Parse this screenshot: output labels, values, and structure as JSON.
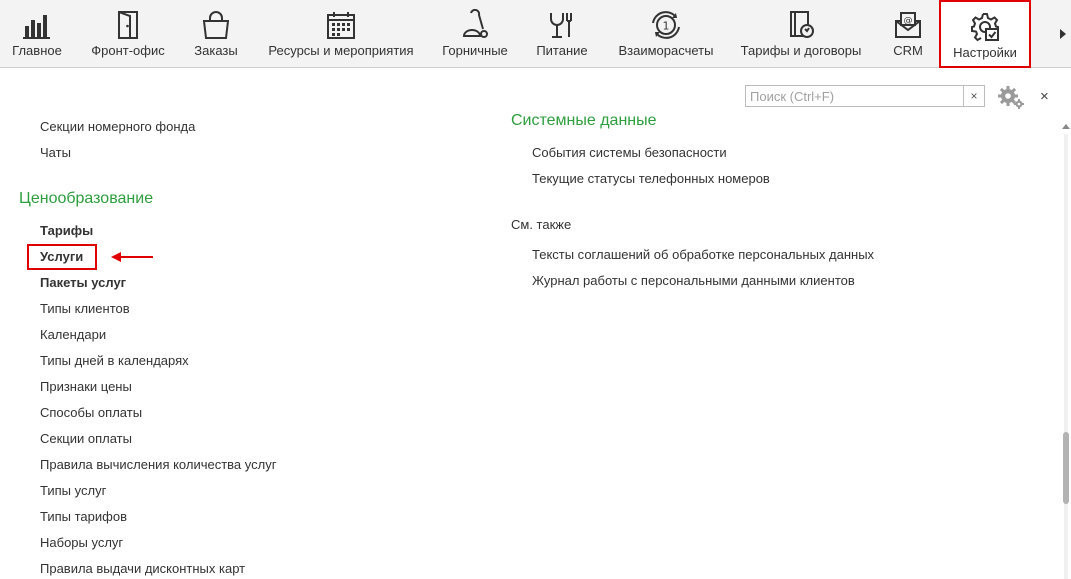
{
  "toolbar": {
    "items": [
      {
        "label": "Главное",
        "icon": "bar-chart-icon"
      },
      {
        "label": "Фронт-офис",
        "icon": "door-icon"
      },
      {
        "label": "Заказы",
        "icon": "shopping-bag-icon"
      },
      {
        "label": "Ресурсы и мероприятия",
        "icon": "calendar-icon"
      },
      {
        "label": "Горничные",
        "icon": "vacuum-icon"
      },
      {
        "label": "Питание",
        "icon": "cup-fork-icon"
      },
      {
        "label": "Взаиморасчеты",
        "icon": "coin-cycle-icon"
      },
      {
        "label": "Тарифы и договоры",
        "icon": "contract-icon"
      },
      {
        "label": "CRM",
        "icon": "crm-envelope-icon"
      },
      {
        "label": "Настройки",
        "icon": "settings-gear-icon"
      }
    ],
    "active_index": 9
  },
  "search": {
    "placeholder": "Поиск (Ctrl+F)",
    "value": "",
    "clear_label": "×"
  },
  "close_label": "×",
  "left_column": {
    "top_items": [
      "Секции номерного фонда",
      "Чаты"
    ],
    "pricing_group": {
      "title": "Ценообразование",
      "items": [
        {
          "label": "Тарифы",
          "bold": true
        },
        {
          "label": "Услуги",
          "bold": true
        },
        {
          "label": "Пакеты услуг",
          "bold": true
        },
        {
          "label": "Типы клиентов",
          "bold": false
        },
        {
          "label": "Календари",
          "bold": false
        },
        {
          "label": "Типы дней в календарях",
          "bold": false
        },
        {
          "label": "Признаки цены",
          "bold": false
        },
        {
          "label": "Способы оплаты",
          "bold": false
        },
        {
          "label": "Секции оплаты",
          "bold": false
        },
        {
          "label": "Правила вычисления количества услуг",
          "bold": false
        },
        {
          "label": "Типы услуг",
          "bold": false
        },
        {
          "label": "Типы тарифов",
          "bold": false
        },
        {
          "label": "Наборы услуг",
          "bold": false
        },
        {
          "label": "Правила выдачи дисконтных карт",
          "bold": false
        }
      ]
    }
  },
  "right_column": {
    "system_group": {
      "title": "Системные данные",
      "items": [
        "События системы безопасности",
        "Текущие статусы телефонных номеров"
      ]
    },
    "see_also": {
      "title": "См. также",
      "items": [
        "Тексты соглашений об обработке персональных данных",
        "Журнал работы с персональными данными клиентов"
      ]
    }
  },
  "colors": {
    "group_title": "#2e9e3e",
    "highlight": "#e10000",
    "toolbar_bg": "#f3f3f3"
  }
}
